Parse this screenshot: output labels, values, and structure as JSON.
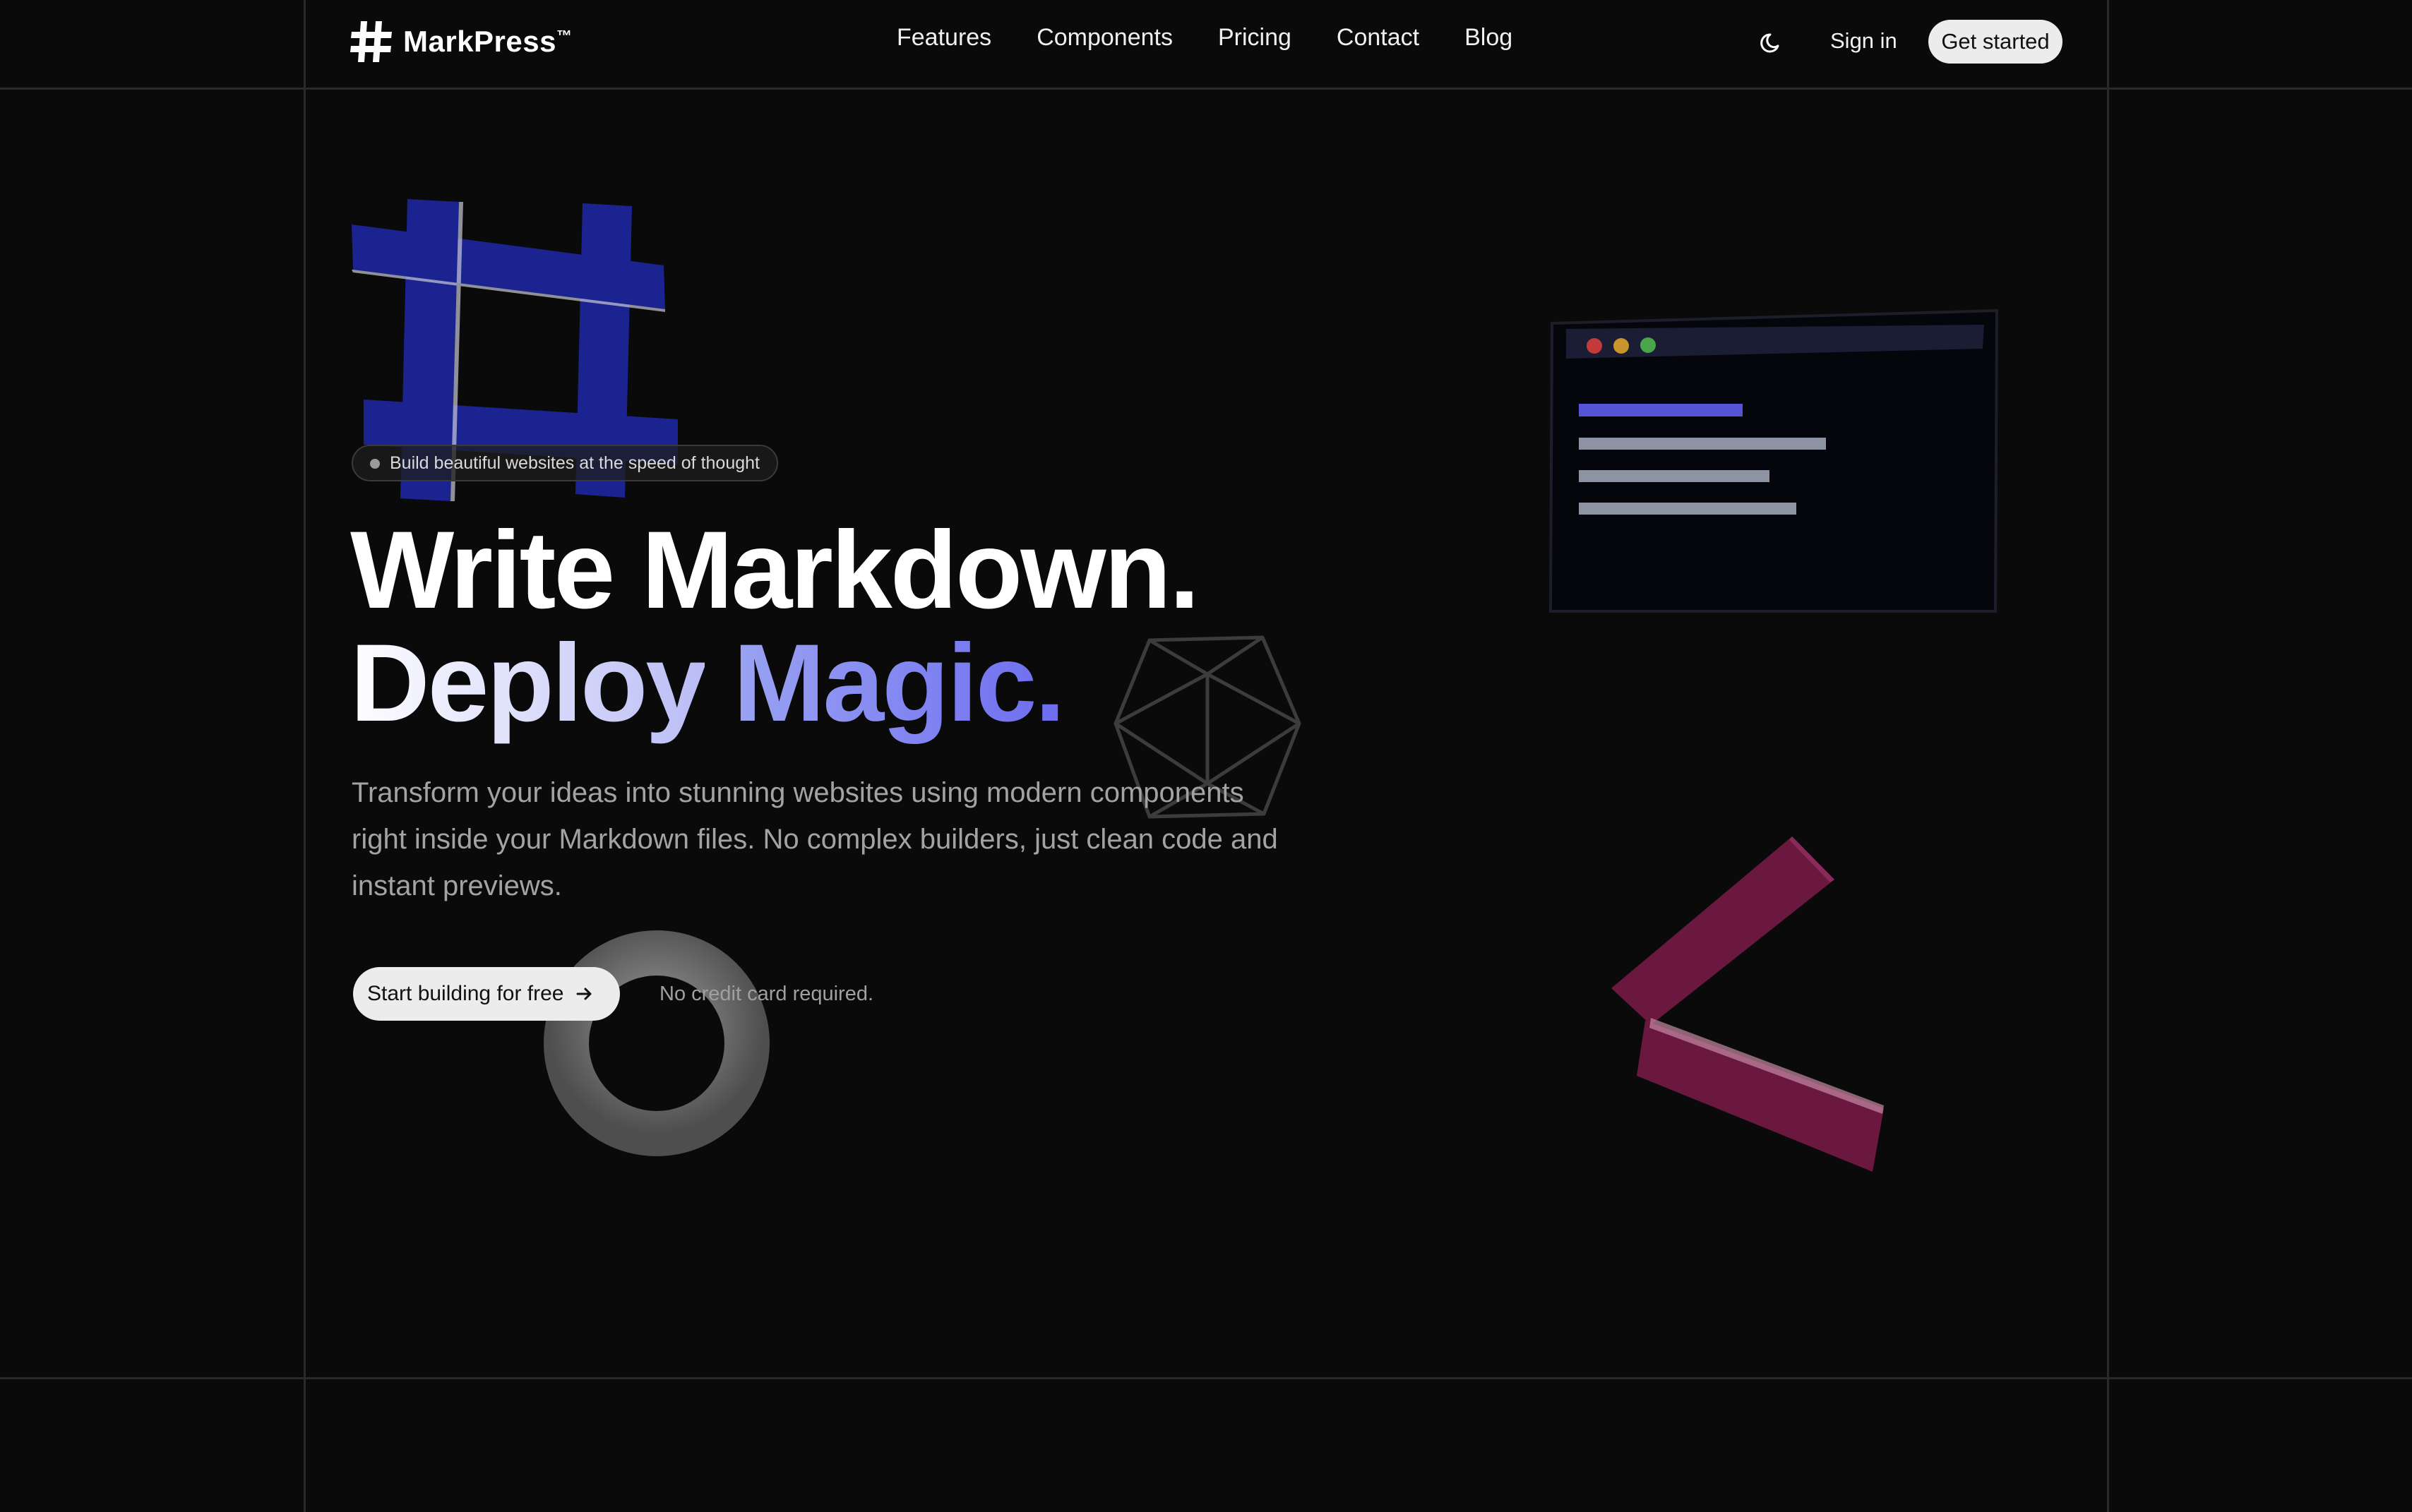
{
  "brand": {
    "name": "MarkPress",
    "trademark": "™"
  },
  "nav": {
    "items": [
      "Features",
      "Components",
      "Pricing",
      "Contact",
      "Blog"
    ],
    "theme_icon": "moon-icon",
    "sign_in": "Sign in",
    "get_started": "Get started"
  },
  "hero": {
    "badge": "Build beautiful websites at the speed of thought",
    "headline_line1": "Write Markdown.",
    "headline_word1": "Deploy",
    "headline_word2": "Magic.",
    "description": "Transform your ideas into stunning websites using modern components right inside your Markdown files. No complex builders, just clean code and instant previews.",
    "cta_label": "Start building for free",
    "cta_icon": "arrow-right-icon",
    "note": "No credit card required."
  },
  "colors": {
    "background": "#0a0a0a",
    "accent": "#6d6cf0",
    "hash_blue": "#1b2390",
    "chevron": "#6b1840",
    "button": "#ececec"
  }
}
